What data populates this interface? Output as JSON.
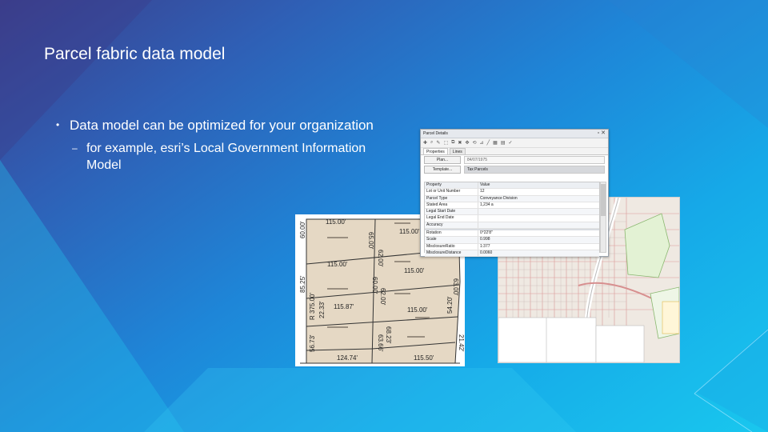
{
  "slide": {
    "title": "Parcel fabric data model",
    "bullets": [
      {
        "text": "Data model can be optimized for your organization"
      }
    ],
    "sub_bullets": [
      {
        "text": "for example, esri’s Local Government Information Model"
      }
    ]
  },
  "parcel_details": {
    "window_title": "Parcel Details",
    "tabs": [
      "Properties",
      "Lines"
    ],
    "plan_button": "Plan...",
    "plan_value": "84/07/1975",
    "template_button": "Template...",
    "template_value": "Tax Parcels",
    "columns": [
      "Property",
      "Value"
    ],
    "rows": [
      {
        "property": "Lot or Unit Number",
        "value": "12"
      },
      {
        "property": "Parcel Type",
        "value": "Conveyance Division"
      },
      {
        "property": "Stated Area",
        "value": "1,234 a"
      },
      {
        "property": "Legal Start Date",
        "value": ""
      },
      {
        "property": "Legal End Date",
        "value": ""
      },
      {
        "property": "Accuracy",
        "value": ""
      },
      {
        "property": "Rotation",
        "value": "0°22'8\""
      },
      {
        "property": "Scale",
        "value": "0.998"
      },
      {
        "property": "MisclosureRatio",
        "value": "1:377"
      },
      {
        "property": "MisclosureDistance",
        "value": "0.0060"
      }
    ]
  },
  "parcel_plan": {
    "dimensions": [
      "115.00'",
      "115.00'",
      "65.00'",
      "62.00'",
      "60.00'",
      "115.00'",
      "115.00'",
      "63.00'",
      "60.00'",
      "62.00'",
      "R 375.00'",
      "22.33'",
      "115.87'",
      "115.00'",
      "85.25'",
      "54.20'",
      "56.73'",
      "124.74'",
      "115.50'",
      "63.66'",
      "68.23'",
      "21.42'"
    ]
  }
}
